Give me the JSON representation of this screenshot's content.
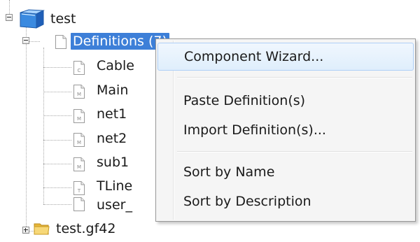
{
  "tree": {
    "root": {
      "label": "test"
    },
    "definitions": {
      "label": "Definitions (7)"
    },
    "children": [
      {
        "label": "Cable",
        "icon_letter": "C"
      },
      {
        "label": "Main",
        "icon_letter": "M"
      },
      {
        "label": "net1",
        "icon_letter": "M"
      },
      {
        "label": "net2",
        "icon_letter": "M"
      },
      {
        "label": "sub1",
        "icon_letter": "M"
      },
      {
        "label": "TLine",
        "icon_letter": "T"
      },
      {
        "label": "user_",
        "icon_letter": ""
      }
    ],
    "sibling": {
      "label": "test.gf42"
    }
  },
  "context_menu": {
    "items": [
      {
        "label": "Component Wizard..."
      },
      {
        "label": "Paste Definition(s)"
      },
      {
        "label": "Import Definition(s)..."
      },
      {
        "label": "Sort by Name"
      },
      {
        "label": "Sort by Description"
      }
    ]
  },
  "colors": {
    "selection": "#3d7fd8",
    "menu_background": "#f5f5f5",
    "menu_highlight": "#dfeefc",
    "folder": "#f2c94c",
    "project_cube": "#2f7fd6"
  }
}
